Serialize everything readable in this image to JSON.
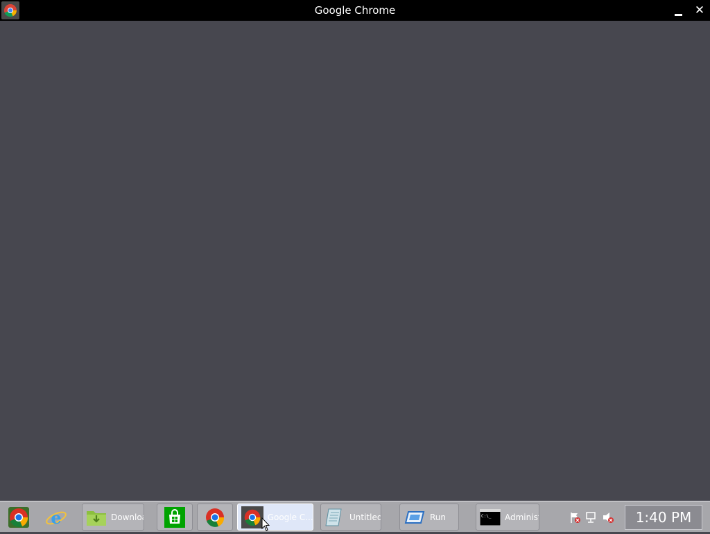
{
  "window": {
    "title": "Google Chrome",
    "minimize_symbol": "",
    "close_symbol": "✕"
  },
  "taskbar": {
    "pinned": [
      {
        "name": "chrome-canary-icon"
      },
      {
        "name": "internet-explorer-icon"
      }
    ],
    "tasks": [
      {
        "label": "Downloads",
        "icon": "folder-download-icon"
      },
      {
        "label": "",
        "icon": "store-icon"
      },
      {
        "label": "",
        "icon": "chrome-icon"
      },
      {
        "label": "Google C...",
        "icon": "chrome-icon",
        "active": true
      },
      {
        "label": "Untitled - ...",
        "icon": "notepad-icon"
      },
      {
        "label": "Run",
        "icon": "run-icon"
      },
      {
        "label": "Administ...",
        "icon": "cmd-icon"
      }
    ],
    "tray_icons": [
      "action-center-flag-icon",
      "network-icon",
      "volume-muted-icon"
    ],
    "clock": "1:40 PM"
  },
  "colors": {
    "content_bg": "#47474f",
    "titlebar_bg": "#000000",
    "taskbar_bg": "#a7a7ab"
  }
}
